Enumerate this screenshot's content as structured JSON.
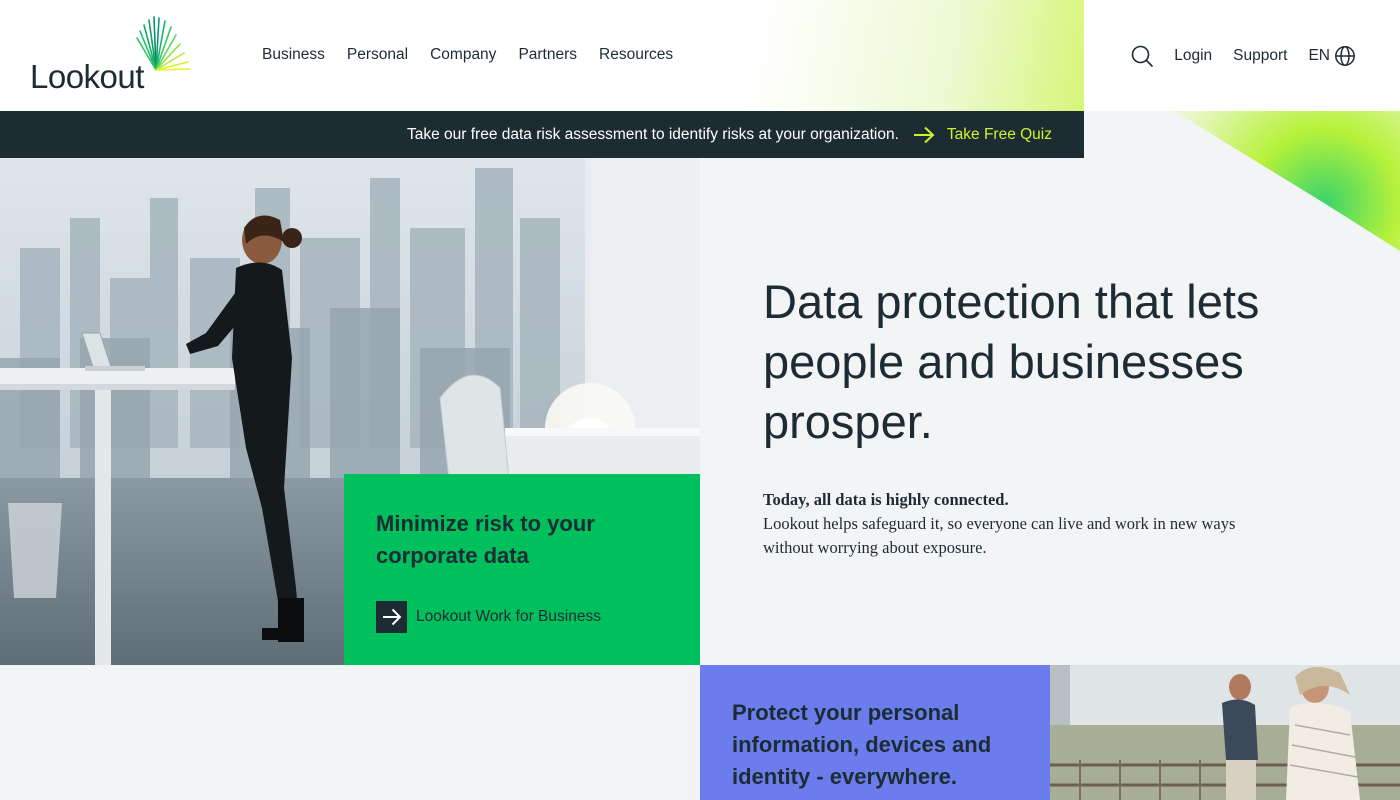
{
  "brand": {
    "name": "Lookout"
  },
  "nav": {
    "items": [
      {
        "label": "Business"
      },
      {
        "label": "Personal"
      },
      {
        "label": "Company"
      },
      {
        "label": "Partners"
      },
      {
        "label": "Resources"
      }
    ]
  },
  "utility": {
    "search_icon": "search-icon",
    "login_label": "Login",
    "support_label": "Support",
    "language_label": "EN",
    "language_icon": "globe-icon"
  },
  "banner": {
    "text": "Take our free data risk assessment to identify risks at your organization.",
    "link_label": "Take Free Quiz",
    "arrow_icon": "arrow-right-icon"
  },
  "hero": {
    "heading": "Data protection that lets people and businesses prosper.",
    "body_strong": "Today, all data is highly connected.",
    "body": "Lookout helps safeguard it, so everyone can live and work in new ways without worrying about exposure."
  },
  "business_card": {
    "title": "Minimize risk to your corporate data",
    "cta_label": "Lookout Work for Business",
    "cta_icon": "arrow-right-icon"
  },
  "personal_card": {
    "title": "Protect your personal information, devices and identity - everywhere."
  },
  "colors": {
    "dark": "#1d2b33",
    "accent_lime": "#cdf22b",
    "business_green": "#00c05d",
    "personal_blue": "#6b7ced",
    "page_bg": "#f3f4f6"
  }
}
